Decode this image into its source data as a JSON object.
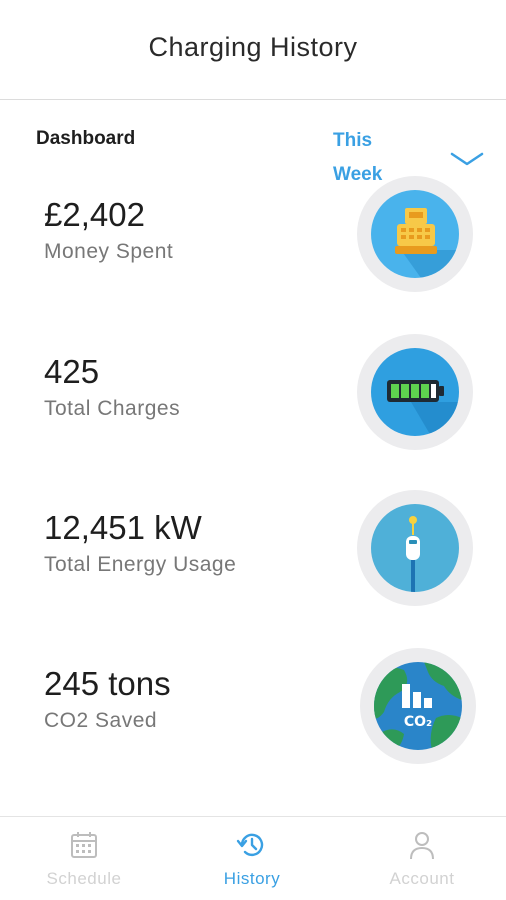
{
  "header": {
    "title": "Charging History"
  },
  "dashboard": {
    "label": "Dashboard",
    "period": {
      "line1": "This",
      "line2": "Week",
      "icon": "chevron-down-icon"
    }
  },
  "stats": [
    {
      "value": "£2,402",
      "label": "Money Spent",
      "icon": "cash-register-icon"
    },
    {
      "value": "425",
      "label": "Total Charges",
      "icon": "battery-icon"
    },
    {
      "value": "12,451 kW",
      "label": "Total Energy Usage",
      "icon": "charging-plug-icon"
    },
    {
      "value": "245 tons",
      "label": "CO2 Saved",
      "icon": "earth-co2-icon",
      "icon_text": "CO₂"
    }
  ],
  "tabs": [
    {
      "label": "Schedule",
      "icon": "calendar-icon",
      "active": false
    },
    {
      "label": "History",
      "icon": "history-icon",
      "active": true
    },
    {
      "label": "Account",
      "icon": "person-icon",
      "active": false
    }
  ],
  "colors": {
    "accent": "#3aa0e3",
    "text": "#1e1e1e",
    "muted": "#777777",
    "inactive": "#d2d2d2"
  }
}
